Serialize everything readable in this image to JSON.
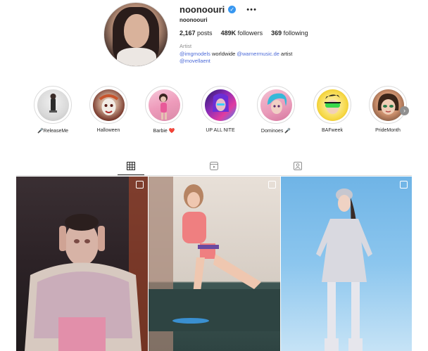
{
  "profile": {
    "username": "noonoouri",
    "full_name": "noonoouri",
    "verified_icon": "verified-badge-icon",
    "more_icon": "more-options-icon",
    "posts_count": "2,167",
    "posts_label": "posts",
    "followers_count": "489K",
    "followers_label": "followers",
    "following_count": "369",
    "following_label": "following",
    "category": "Artist",
    "bio_line1_mention1": "@imgmodels",
    "bio_line1_text1": " worldwide ",
    "bio_line1_mention2": "@warnermusic.de",
    "bio_line1_text2": " artist",
    "bio_line2_mention": "@movellaent"
  },
  "highlights": [
    {
      "label": "🎤ReleaseMe"
    },
    {
      "label": "Halloween"
    },
    {
      "label": "Barbie ❤️"
    },
    {
      "label": "UP ALL NITE"
    },
    {
      "label": "Dominoes 🎤"
    },
    {
      "label": "BAFweek"
    },
    {
      "label": "PrideMonth"
    }
  ],
  "tabs": [
    {
      "name": "posts",
      "icon": "grid-icon",
      "active": true
    },
    {
      "name": "reels",
      "icon": "reels-icon",
      "active": false
    },
    {
      "name": "tagged",
      "icon": "tagged-icon",
      "active": false
    }
  ],
  "colors": {
    "link": "#4d6bd8",
    "verified": "#3897f0",
    "border": "#dbdbdb"
  }
}
